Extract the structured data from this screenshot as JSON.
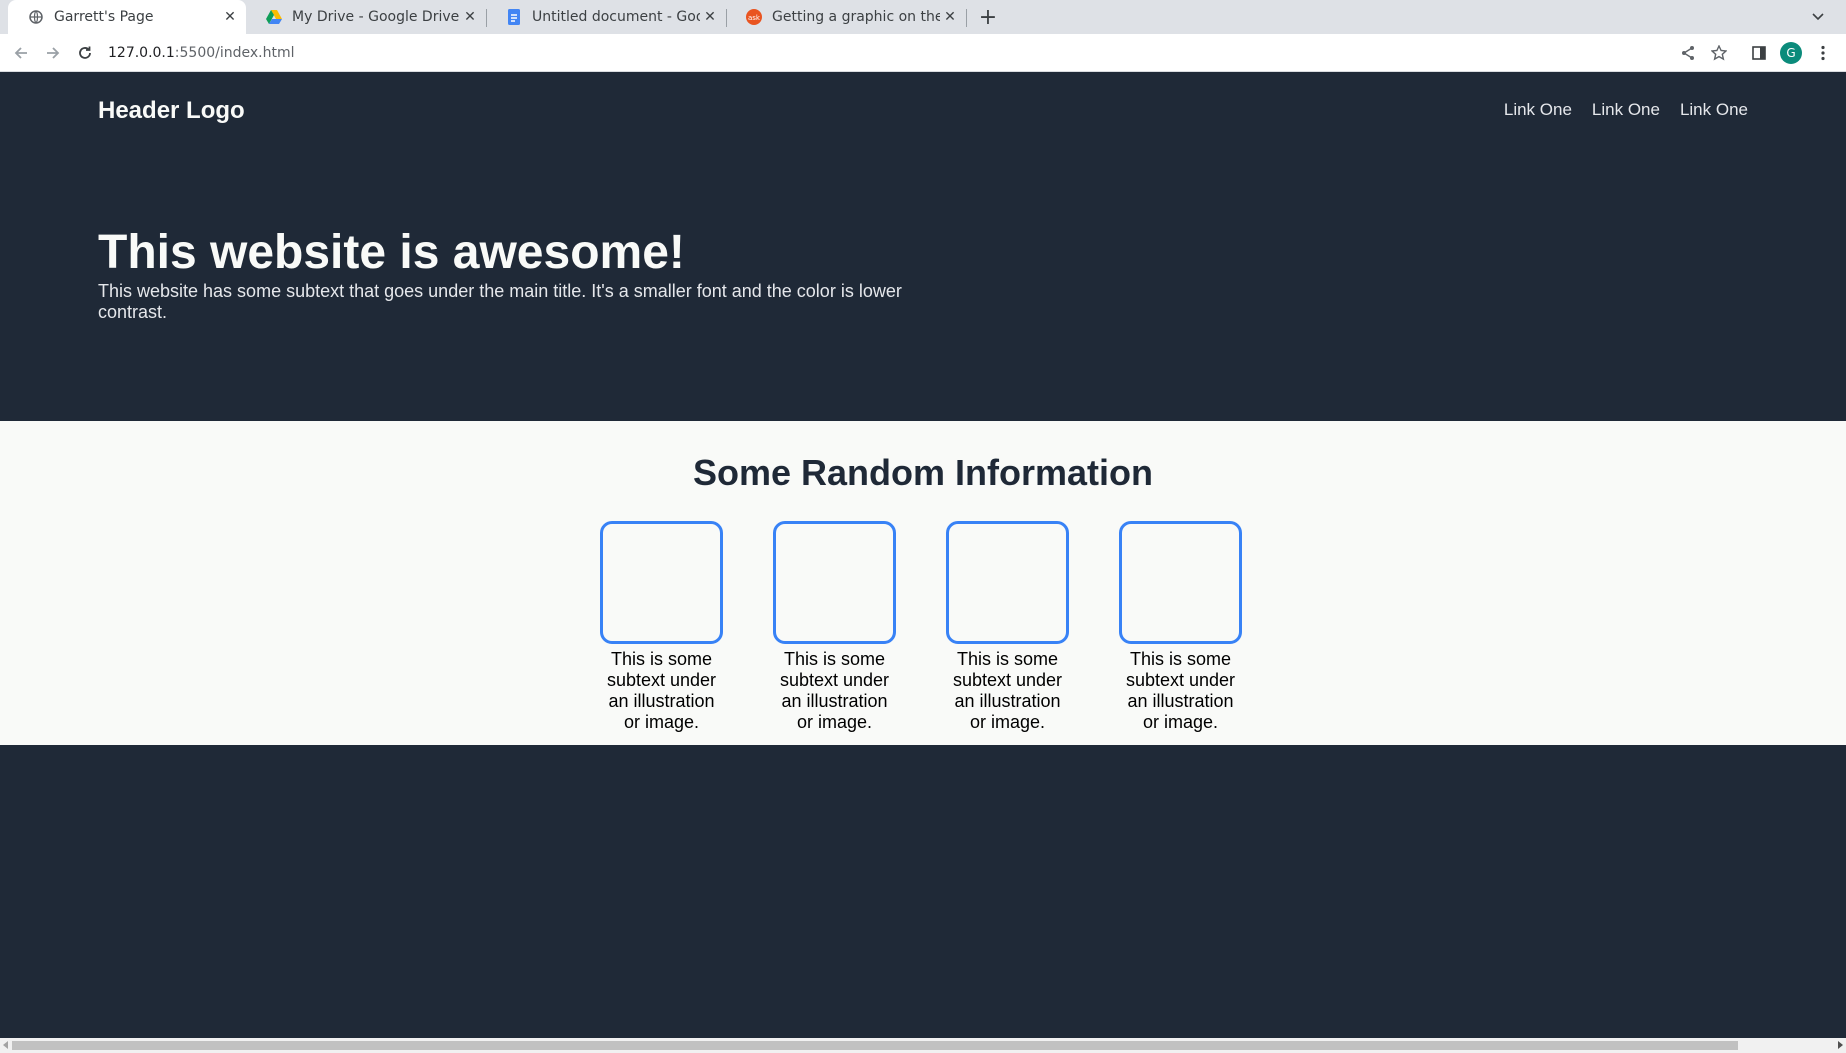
{
  "browser": {
    "tabs": [
      {
        "title": "Garrett's Page",
        "icon": "globe-icon",
        "active": true
      },
      {
        "title": "My Drive - Google Drive",
        "icon": "google-drive-icon",
        "active": false
      },
      {
        "title": "Untitled document - Goog",
        "icon": "google-docs-icon",
        "active": false
      },
      {
        "title": "Getting a graphic on the c",
        "icon": "ask-ubuntu-icon",
        "active": false
      }
    ],
    "url_host": "127.0.0.1",
    "url_path": ":5500/index.html",
    "profile_initial": "G"
  },
  "header": {
    "logo": "Header Logo",
    "links": [
      "Link One",
      "Link One",
      "Link One"
    ]
  },
  "hero": {
    "title": "This website is awesome!",
    "subtitle": "This website has some subtext that goes under the main title. It's a smaller font and the color is lower contrast."
  },
  "info": {
    "title": "Some Random Information",
    "cards": [
      {
        "caption": "This is some subtext under an illustration or image."
      },
      {
        "caption": "This is some subtext under an illustration or image."
      },
      {
        "caption": "This is some subtext under an illustration or image."
      },
      {
        "caption": "This is some subtext under an illustration or image."
      }
    ]
  },
  "colors": {
    "dark_background": "#1f2937",
    "light_background": "#f9faf8",
    "card_border": "#3882f6"
  }
}
